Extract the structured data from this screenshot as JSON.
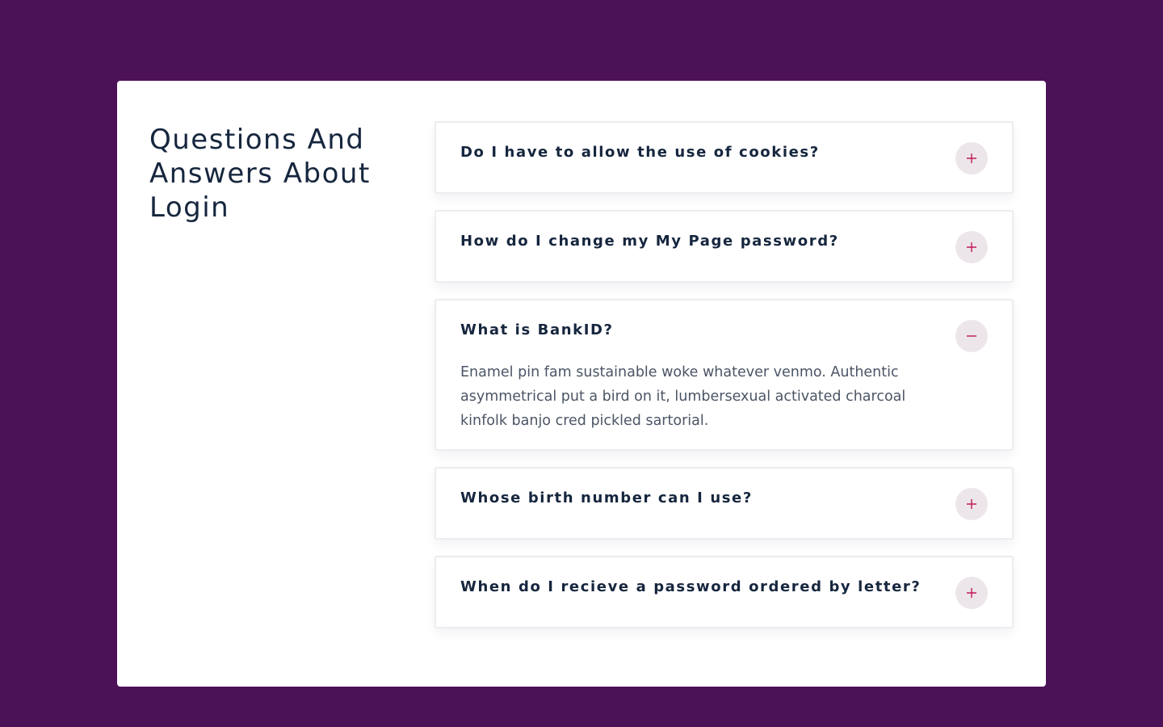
{
  "page": {
    "title": "Questions And Answers About Login"
  },
  "faq": {
    "items": [
      {
        "question": "Do I have to allow the use of cookies?",
        "icon": "plus-icon",
        "expanded": false
      },
      {
        "question": "How do I change my My Page password?",
        "icon": "plus-icon",
        "expanded": false
      },
      {
        "question": "What is BankID?",
        "icon": "minus-icon",
        "expanded": true,
        "answer": "Enamel pin fam sustainable woke whatever venmo. Authentic asymmetrical put a bird on it, lumbersexual activated charcoal kinfolk banjo cred pickled sartorial."
      },
      {
        "question": "Whose birth number can I use?",
        "icon": "plus-icon",
        "expanded": false
      },
      {
        "question": "When do I recieve a password ordered by letter?",
        "icon": "plus-icon",
        "expanded": false
      }
    ]
  },
  "colors": {
    "background": "#4c1258",
    "card": "#ffffff",
    "heading": "#16263e",
    "body_text": "#4b5565",
    "toggle_bg": "#ece6ea",
    "toggle_icon": "#c2185b",
    "item_border": "#ececf1"
  }
}
